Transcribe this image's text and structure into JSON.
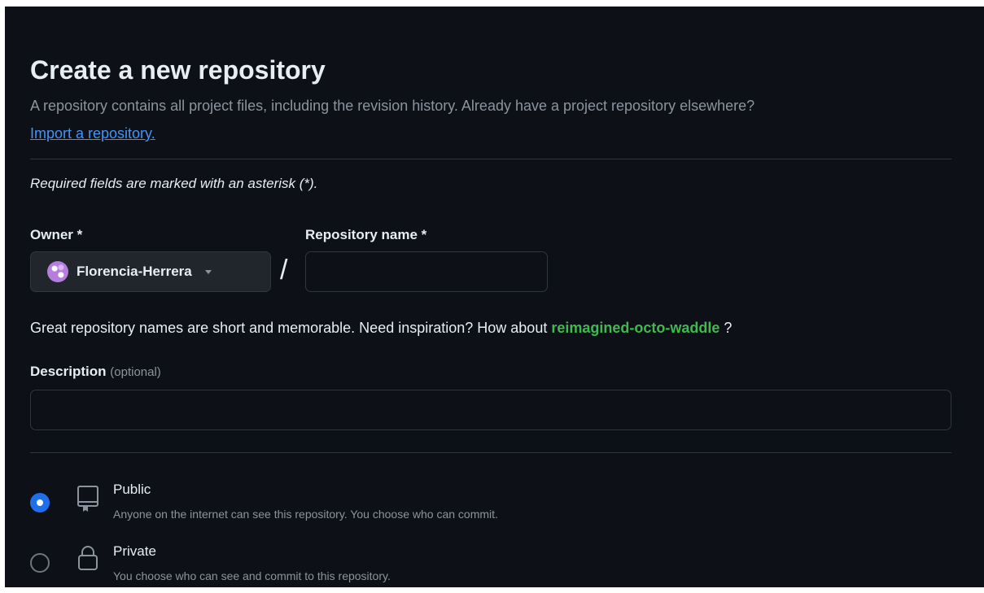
{
  "header": {
    "title": "Create a new repository",
    "subtitle": "A repository contains all project files, including the revision history. Already have a project repository elsewhere?",
    "import_link": "Import a repository."
  },
  "form": {
    "required_note": "Required fields are marked with an asterisk (*).",
    "owner": {
      "label": "Owner *",
      "selected": "Florencia-Herrera"
    },
    "separator": "/",
    "repo_name": {
      "label": "Repository name *",
      "value": ""
    },
    "hint": {
      "prefix": "Great repository names are short and memorable. Need inspiration? How about ",
      "suggestion": "reimagined-octo-waddle",
      "suffix": " ?"
    },
    "description": {
      "label": "Description",
      "optional": "(optional)",
      "value": ""
    },
    "visibility": {
      "selected": "public",
      "options": [
        {
          "id": "public",
          "title": "Public",
          "description": "Anyone on the internet can see this repository. You choose who can commit.",
          "icon": "repo-icon"
        },
        {
          "id": "private",
          "title": "Private",
          "description": "You choose who can see and commit to this repository.",
          "icon": "lock-icon"
        }
      ]
    }
  },
  "colors": {
    "background": "#0d1117",
    "link": "#4493f8",
    "suggestion": "#3fb950",
    "radio_checked": "#1f6feb",
    "muted_text": "#8b949e",
    "border": "#30363d"
  }
}
